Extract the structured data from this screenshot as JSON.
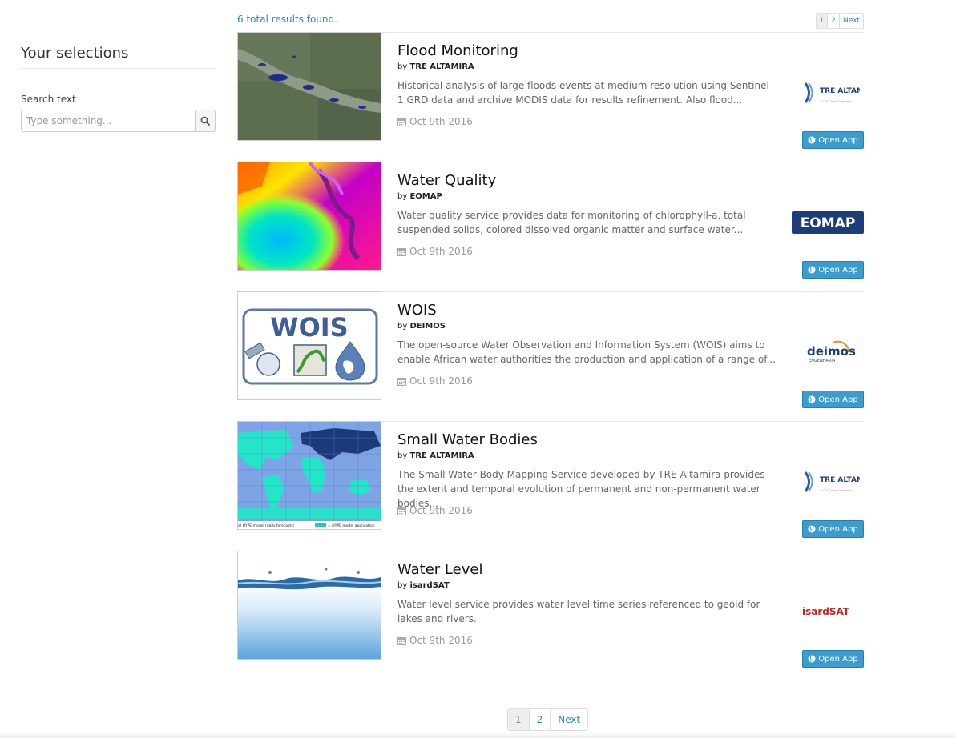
{
  "sidebar": {
    "title": "Your selections",
    "search_label": "Search text",
    "search_placeholder": "Type something...",
    "search_icon": "search-icon"
  },
  "results": {
    "total_text": "6 total results found.",
    "pagination": [
      "1",
      "2",
      "Next"
    ]
  },
  "items": [
    {
      "title": "Flood Monitoring",
      "by_prefix": "by",
      "author": "TRE ALTAMIRA",
      "description": "Historical analysis of large floods events at medium resolution using Sentinel-1 GRD data and archive MODIS data for results refinement. Also flood...",
      "date": "Oct 9th 2016",
      "logo_text": "TRE ALTAMIRA",
      "logo_subtext": "A CLS Group Company",
      "button": "Open App"
    },
    {
      "title": "Water Quality",
      "by_prefix": "by",
      "author": "EOMAP",
      "description": "Water quality service provides data for monitoring of chlorophyll-a, total suspended solids, colored dissolved organic matter and surface water...",
      "date": "Oct 9th 2016",
      "logo_text": "EOMAP",
      "button": "Open App"
    },
    {
      "title": "WOIS",
      "by_prefix": "by",
      "author": "DEIMOS",
      "description": "The open-source Water Observation and Information System (WOIS) aims to enable African water authorities the production and application of a range of...",
      "date": "Oct 9th 2016",
      "thumb_text": "WOIS",
      "logo_text": "deimos",
      "logo_subtext": "ENGENHARIA",
      "button": "Open App"
    },
    {
      "title": "Small Water Bodies",
      "by_prefix": "by",
      "author": "TRE ALTAMIRA",
      "description": "The Small Water Body Mapping Service developed by TRE-Altamira provides the extent and temporal evolution of permanent and non-permanent water bodies...",
      "date": "Oct 9th 2016",
      "thumb_legend_1": "al HYPE model (daily forecasts)",
      "thumb_legend_2": "= HYPE model application",
      "logo_text": "TRE ALTAMIRA",
      "logo_subtext": "A CLS Group Company",
      "button": "Open App"
    },
    {
      "title": "Water Level",
      "by_prefix": "by",
      "author": "isardSAT",
      "description": "Water level service provides water level time series referenced to geoid for lakes and rivers.",
      "date": "Oct 9th 2016",
      "logo_text": "isardSAT",
      "button": "Open App"
    }
  ],
  "bottom_pagination": [
    "1",
    "2",
    "Next"
  ],
  "colors": {
    "accent": "#2a8ab6",
    "button": "#3a9ccf"
  }
}
